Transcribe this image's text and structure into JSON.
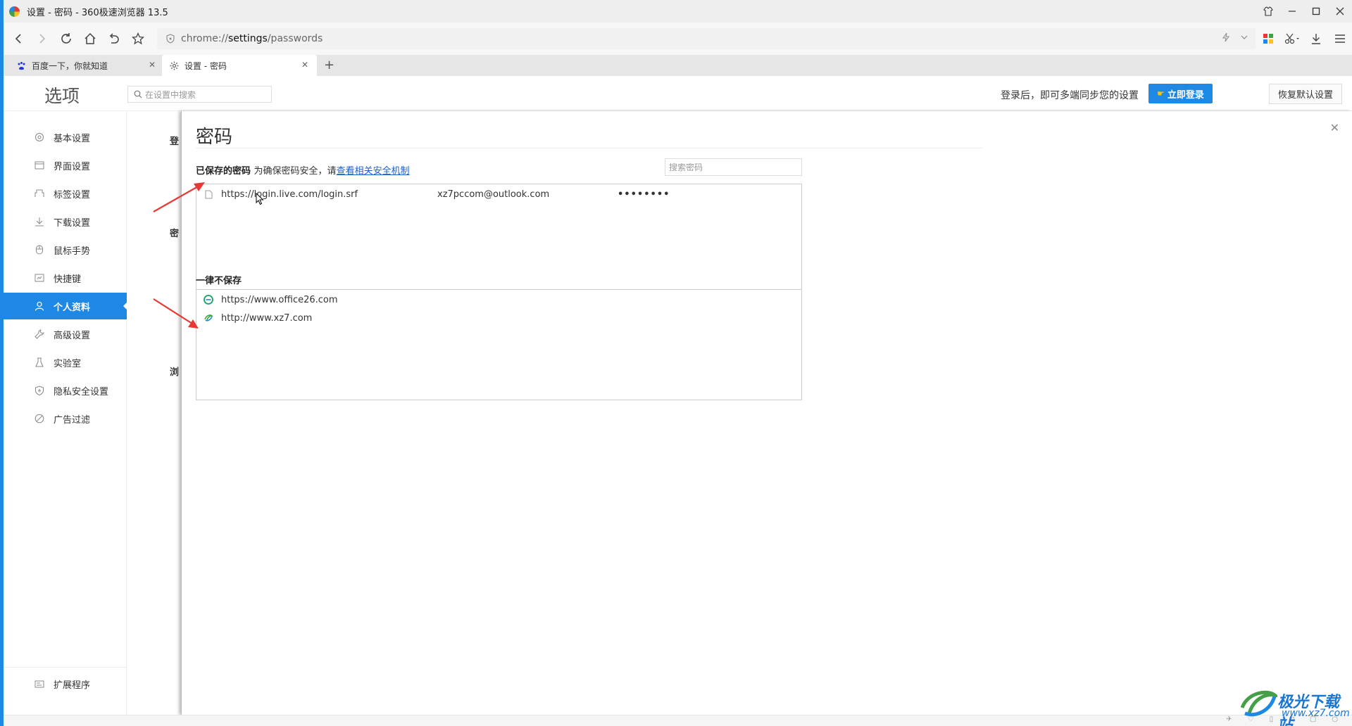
{
  "window": {
    "title": "设置 - 密码 - 360极速浏览器 13.5"
  },
  "address_bar": {
    "url_prefix": "chrome://",
    "url_host": "settings",
    "url_path": "/passwords"
  },
  "tabs": [
    {
      "label": "百度一下，你就知道",
      "active": false
    },
    {
      "label": "设置 - 密码",
      "active": true
    }
  ],
  "header": {
    "title": "选项",
    "search_placeholder": "在设置中搜索",
    "sync_text": "登录后，即可多端同步您的设置",
    "login_button": "立即登录",
    "restore_button": "恢复默认设置"
  },
  "sidebar": {
    "items": [
      {
        "label": "基本设置",
        "icon": "gear-icon"
      },
      {
        "label": "界面设置",
        "icon": "window-icon"
      },
      {
        "label": "标签设置",
        "icon": "tab-icon"
      },
      {
        "label": "下载设置",
        "icon": "download-icon"
      },
      {
        "label": "鼠标手势",
        "icon": "mouse-icon"
      },
      {
        "label": "快捷键",
        "icon": "keyboard-icon"
      },
      {
        "label": "个人资料",
        "icon": "user-icon",
        "active": true
      },
      {
        "label": "高级设置",
        "icon": "wrench-icon"
      },
      {
        "label": "实验室",
        "icon": "flask-icon"
      },
      {
        "label": "隐私安全设置",
        "icon": "shield-icon"
      },
      {
        "label": "广告过滤",
        "icon": "block-icon"
      }
    ],
    "extensions": "扩展程序"
  },
  "background_fragments": [
    "登",
    "密",
    "浏"
  ],
  "dialog": {
    "title": "密码",
    "saved_label": "已保存的密码",
    "saved_note": "为确保密码安全，请",
    "saved_link": "查看相关安全机制",
    "search_placeholder": "搜索密码",
    "saved_passwords": [
      {
        "site": "https://login.live.com/login.srf",
        "username": "xz7pccom@outlook.com",
        "password": "••••••••"
      }
    ],
    "never_label": "一律不保存",
    "never_saved": [
      {
        "site": "https://www.office26.com"
      },
      {
        "site": "http://www.xz7.com"
      }
    ]
  },
  "watermark": {
    "title": "极光下载站",
    "url": "www.xz7.com"
  },
  "colors": {
    "accent": "#1e88e5",
    "arrow": "#e53935"
  }
}
